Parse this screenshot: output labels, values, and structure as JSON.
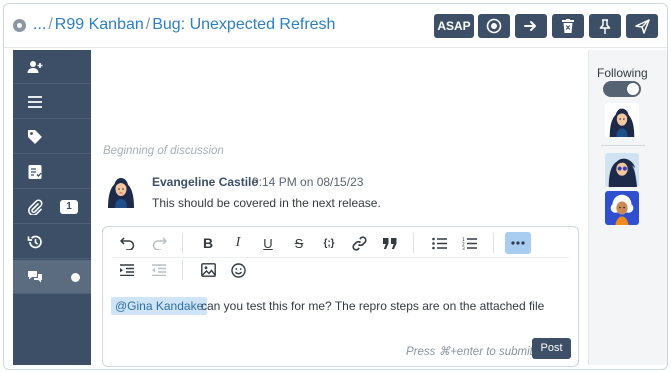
{
  "breadcrumb": {
    "ellipsis": "...",
    "board": "R99 Kanban",
    "card": "Bug: Unexpected Refresh",
    "separator": "/"
  },
  "header_actions": {
    "asap_label": "ASAP",
    "icons": [
      "record-icon",
      "arrow-right-icon",
      "trash-icon",
      "pin-icon",
      "send-icon"
    ]
  },
  "sidebar": {
    "items": [
      {
        "icon": "add-user-icon"
      },
      {
        "icon": "list-icon"
      },
      {
        "icon": "tag-icon"
      },
      {
        "icon": "checklist-icon"
      },
      {
        "icon": "paperclip-icon",
        "badge": "1"
      },
      {
        "icon": "history-icon"
      },
      {
        "icon": "chat-icon",
        "active": true
      }
    ]
  },
  "discussion": {
    "beginning_label": "Beginning of discussion",
    "comments": [
      {
        "author": "Evangeline Castile",
        "timestamp": "9:14 PM on 08/15/23",
        "text": "This should be covered in the next release."
      }
    ]
  },
  "editor": {
    "toolbar_row1": [
      "undo-icon",
      "redo-icon",
      "bold-icon",
      "italic-icon",
      "underline-icon",
      "strikethrough-icon",
      "code-icon",
      "link-icon",
      "quote-icon",
      "bullet-list-icon",
      "numbered-list-icon",
      "more-icon"
    ],
    "toolbar_row2": [
      "indent-icon",
      "outdent-icon",
      "image-icon",
      "emoji-icon"
    ],
    "mention": "@Gina Kandake",
    "text": "can you test this for me? The repro steps are on the attached file",
    "hint": "Press ⌘+enter to submit",
    "post_label": "Post"
  },
  "right_panel": {
    "following_label": "Following",
    "following_on": true
  },
  "colors": {
    "nav_bg": "#3c4f66",
    "accent_link": "#2d7fc1",
    "mention_bg": "#cfe5f7"
  }
}
